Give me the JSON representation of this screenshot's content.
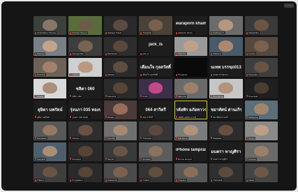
{
  "window": {
    "minimize_label": "···"
  },
  "tiles": [
    {
      "big": "",
      "caption": "Chutcharan Trisuree",
      "bg": "#3c3f3a",
      "face": "#8a7a6a",
      "sel": false
    },
    {
      "big": "",
      "caption": "Praiwan Sai-poo",
      "bg": "#5a6b3c",
      "face": "#6f5b4a",
      "sel": false
    },
    {
      "big": "",
      "caption": "Nattapol Srisuk",
      "bg": "#2a2a2a",
      "face": "#5d4c40",
      "sel": false
    },
    {
      "big": "",
      "caption": "Thiraphat",
      "bg": "#4a4238",
      "face": "#7a6250",
      "sel": false
    },
    {
      "big": "waraporn kham...",
      "caption": "waraporn kham...",
      "bg": "#1d1d1d",
      "face": "",
      "sel": false
    },
    {
      "big": "",
      "caption": "Natthawut T.",
      "bg": "#6b6b6b",
      "face": "#b89a80",
      "sel": false
    },
    {
      "big": "",
      "caption": "Kittisak Boo",
      "bg": "#3a3a3a",
      "face": "#6e5646",
      "sel": false
    },
    {
      "big": "",
      "caption": "Saranya",
      "bg": "#7a7f86",
      "face": "#c9a58a",
      "sel": false
    },
    {
      "big": "",
      "caption": "Nuengruthai",
      "bg": "#3d3d3d",
      "face": "#7c6653",
      "sel": false
    },
    {
      "big": "",
      "caption": "Wachirawit",
      "bg": "#2d2d2d",
      "face": "#5c4a3c",
      "sel": false
    },
    {
      "big": "jack_ls",
      "caption": "jack_ls",
      "bg": "#1d1d1d",
      "face": "",
      "sel": false
    },
    {
      "big": "",
      "caption": "Pattanan",
      "bg": "#9a9a9a",
      "face": "#c2a187",
      "sel": false
    },
    {
      "big": "",
      "caption": "Kittipong",
      "bg": "#4a5a6a",
      "face": "#b28a70",
      "sel": false
    },
    {
      "big": "",
      "caption": "Anucha",
      "bg": "#55493f",
      "face": "#7d6350",
      "sel": false
    },
    {
      "big": "",
      "caption": "Somchai",
      "bg": "#6c6258",
      "face": "#a5826a",
      "sel": false
    },
    {
      "big": "",
      "caption": "Nattida",
      "bg": "#cfcfcf",
      "face": "#b8957c",
      "sel": false
    },
    {
      "big": "",
      "caption": "Sittichai",
      "bg": "#2b2b2b",
      "face": "#624f41",
      "sel": false
    },
    {
      "big": "เดือนใจ กุลสวัสดิ์...",
      "caption": "เดือนใจ กุลสวัสดิ์",
      "bg": "#1d1d1d",
      "face": "",
      "sel": false
    },
    {
      "big": "",
      "caption": "Thanakorn",
      "bg": "#0a0a0a",
      "face": "",
      "sel": false
    },
    {
      "big": "นเทพ บรรชฺถ013",
      "caption": "นเทพ บรรชฺถ013",
      "bg": "#1d1d1d",
      "face": "",
      "sel": false
    },
    {
      "big": "",
      "caption": "Phuwadon",
      "bg": "#3e3e3e",
      "face": "#6b5443",
      "sel": false
    },
    {
      "big": "",
      "caption": "Jirawat",
      "bg": "#d9d9d9",
      "face": "#a98a74",
      "sel": false
    },
    {
      "big": "ชลิตา 060",
      "caption": "ชลิตา 060",
      "bg": "#1d1d1d",
      "face": "",
      "sel": false
    },
    {
      "big": "",
      "caption": "Supachai",
      "bg": "#2a2a2a",
      "face": "#5a4738",
      "sel": false
    },
    {
      "big": "",
      "caption": "Krittin",
      "bg": "#3b2f4a",
      "face": "#c74b8a",
      "sel": false
    },
    {
      "big": "",
      "caption": "Narumon",
      "bg": "#6a6a6a",
      "face": "#a0826c",
      "sel": false
    },
    {
      "big": "",
      "caption": "Pimchanok",
      "bg": "#c6c6c6",
      "face": "#b39077",
      "sel": false
    },
    {
      "big": "",
      "caption": "Theerapat",
      "bg": "#1f1f1f",
      "face": "#4f3f33",
      "sel": false
    },
    {
      "big": "อุษิตา นพรัตน์",
      "caption": "อุษิตา นพรัตน์",
      "bg": "#1d1d1d",
      "face": "",
      "sel": false
    },
    {
      "big": "รุ่งนภา 035 ทองป...",
      "caption": "รุ่งนภา 035 ทองป...",
      "bg": "#1d1d1d",
      "face": "",
      "sel": false
    },
    {
      "big": "",
      "caption": "Wisarut",
      "bg": "#4a3a3a",
      "face": "#9b6f5a",
      "sel": false
    },
    {
      "big": "064 สาวิตรี",
      "caption": "064 สาวิตรี",
      "bg": "#1d1d1d",
      "face": "",
      "sel": false
    },
    {
      "big": "วลัยพิร อภัยทาวรรณ์",
      "caption": "วลัยพิร อภัยทาวรรณ์",
      "bg": "#1d1d1d",
      "face": "",
      "sel": true
    },
    {
      "big": "ชยาทัศน์ ด่านเกิร",
      "caption": "ชยาทัศน์ ด่านเกิร",
      "bg": "#1d1d1d",
      "face": "",
      "sel": false
    },
    {
      "big": "",
      "caption": "Sutthipong",
      "bg": "#5b6e7a",
      "face": "#a4866f",
      "sel": false
    },
    {
      "big": "",
      "caption": "Kanokwan",
      "bg": "#585858",
      "face": "#9a7a64",
      "sel": false
    },
    {
      "big": "",
      "caption": "Chanon",
      "bg": "#2e2e2e",
      "face": "#6e5444",
      "sel": false
    },
    {
      "big": "",
      "caption": "Pornthip",
      "bg": "#6f6f6f",
      "face": "#a68a73",
      "sel": false
    },
    {
      "big": "",
      "caption": "Thanawat",
      "bg": "#363636",
      "face": "#5e4b3d",
      "sel": false
    },
    {
      "big": "",
      "caption": "Ratchanon",
      "bg": "#7c7c7c",
      "face": "#b59479",
      "sel": false
    },
    {
      "big": "",
      "caption": "Nattakarn",
      "bg": "#2c2c2c",
      "face": "#6a5140",
      "sel": false
    },
    {
      "big": "",
      "caption": "Apinya",
      "bg": "#8a8a8a",
      "face": "#c0a088",
      "sel": false
    },
    {
      "big": "",
      "caption": "Kanyarat",
      "bg": "#4f5e6c",
      "face": "#b08f76",
      "sel": false
    },
    {
      "big": "",
      "caption": "Peerapat",
      "bg": "#2a2a2a",
      "face": "#5b4638",
      "sel": false
    },
    {
      "big": "",
      "caption": "Siriporn",
      "bg": "#3a3a3a",
      "face": "#6c5646",
      "sel": false
    },
    {
      "big": "",
      "caption": "Worawut",
      "bg": "#5c5c5c",
      "face": "#8e725e",
      "sel": false
    },
    {
      "big": "iPhone lamprai",
      "caption": "iPhone lamprai",
      "bg": "#1d1d1d",
      "face": "",
      "sel": false
    },
    {
      "big": "มนตรา หาญศิรา",
      "caption": "มนตรา หาญศิรา",
      "bg": "#1d1d1d",
      "face": "",
      "sel": false
    },
    {
      "big": "",
      "caption": "Jaruwan",
      "bg": "#6a6a6a",
      "face": "#a08067",
      "sel": false
    },
    {
      "big": "",
      "caption": "Thitima",
      "bg": "#3e3e3e",
      "face": "#6c5544",
      "sel": false
    },
    {
      "big": "",
      "caption": "Pongsakorn",
      "bg": "#2a2a2a",
      "face": "#5a4739",
      "sel": false
    },
    {
      "big": "",
      "caption": "Nuttanicha",
      "bg": "#4b4b4b",
      "face": "#7d6350",
      "sel": false
    },
    {
      "big": "",
      "caption": "Yuttana",
      "bg": "#333333",
      "face": "#63503f",
      "sel": false
    },
    {
      "big": "",
      "caption": "Chayanin",
      "bg": "#575757",
      "face": "#8d705b",
      "sel": false
    },
    {
      "big": "",
      "caption": "Thanyaluk",
      "bg": "#2f2f2f",
      "face": "#5f4c3d",
      "sel": false
    },
    {
      "big": "",
      "caption": "Sakda",
      "bg": "#444444",
      "face": "#705a48",
      "sel": false
    }
  ]
}
